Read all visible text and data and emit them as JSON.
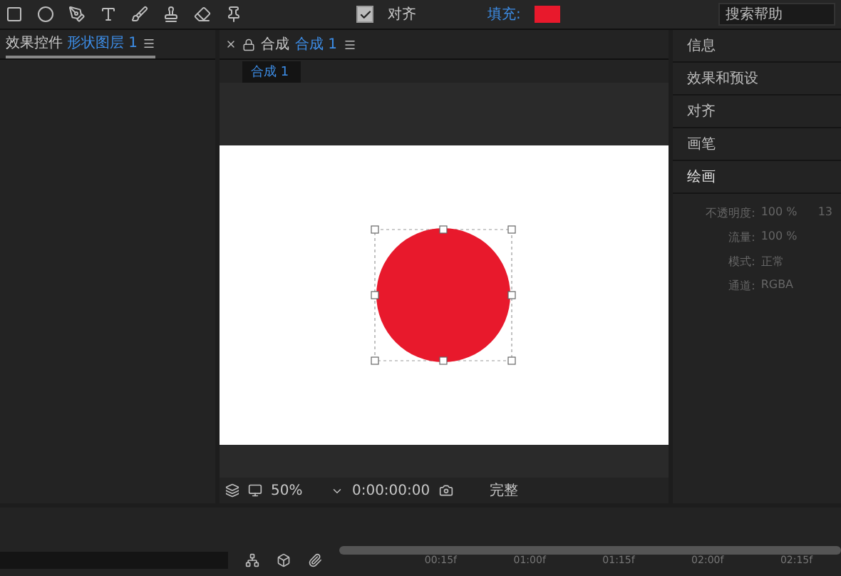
{
  "toolbar": {
    "align": {
      "label": "对齐",
      "checked": true
    },
    "fill_label": "填充:",
    "search": {
      "placeholder": "搜索帮助"
    }
  },
  "effects_panel": {
    "title": "效果控件",
    "layer": "形状图层 1"
  },
  "comp_panel": {
    "tab_label": "合成",
    "tab_name": "合成 1",
    "breadcrumb": "合成 1",
    "zoom": "50%",
    "timecode": "0:00:00:00",
    "quality": "完整"
  },
  "side_panel": {
    "items": [
      {
        "label": "信息"
      },
      {
        "label": "效果和预设"
      },
      {
        "label": "对齐"
      },
      {
        "label": "画笔"
      },
      {
        "label": "绘画"
      }
    ],
    "paint": [
      {
        "label": "不透明度:",
        "value": "100 %"
      },
      {
        "label": "流量:",
        "value": "100 %"
      },
      {
        "label": "模式:",
        "value": "正常"
      },
      {
        "label": "通道:",
        "value": "RGBA"
      }
    ],
    "brush_size": "13"
  },
  "timeline": {
    "ticks": [
      "00:15f",
      "01:00f",
      "01:15f",
      "02:00f",
      "02:15f"
    ]
  }
}
